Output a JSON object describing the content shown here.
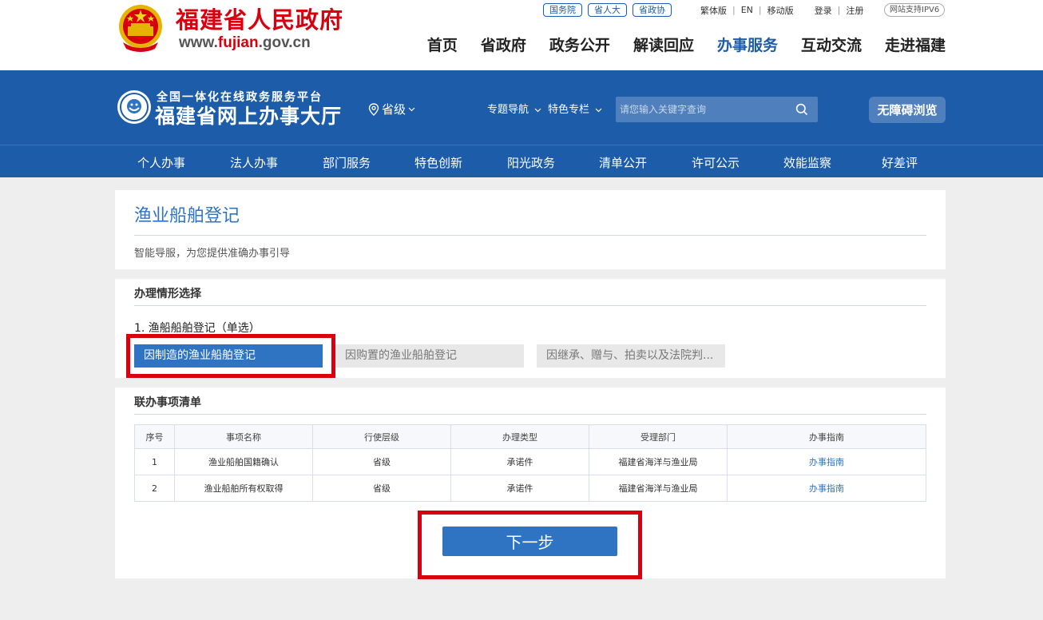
{
  "header": {
    "site_title": "福建省人民政府",
    "url_prefix": "www.",
    "url_highlight": "fujian",
    "url_suffix": ".gov.cn",
    "gov_links": [
      "国务院",
      "省人大",
      "省政协"
    ],
    "util_links": {
      "traditional": "繁体版",
      "english": "EN",
      "mobile": "移动版",
      "login": "登录",
      "register": "注册"
    },
    "ipv6_badge": "网站支持IPV6",
    "main_nav": [
      "首页",
      "省政府",
      "政务公开",
      "解读回应",
      "办事服务",
      "互动交流",
      "走进福建"
    ],
    "main_nav_active": "办事服务"
  },
  "banner": {
    "subtitle": "全国一体化在线政务服务平台",
    "title": "福建省网上办事大厅",
    "region": "省级",
    "menu": [
      "专题导航",
      "特色专栏"
    ],
    "search_placeholder": "请您输入关键字查询",
    "accessibility_label": "无障碍浏览"
  },
  "category_nav": [
    "个人办事",
    "法人办事",
    "部门服务",
    "特色创新",
    "阳光政务",
    "清单公开",
    "许可公示",
    "效能监察",
    "好差评"
  ],
  "page": {
    "title": "渔业船舶登记",
    "description": "智能导服，为您提供准确办事引导"
  },
  "situation": {
    "section_title": "办理情形选择",
    "question": "1. 渔船船舶登记（单选）",
    "options": [
      "因制造的渔业船舶登记",
      "因购置的渔业船舶登记",
      "因继承、赠与、拍卖以及法院判..."
    ],
    "selected_index": 0
  },
  "joint_list": {
    "section_title": "联办事项清单",
    "columns": [
      "序号",
      "事项名称",
      "行使层级",
      "办理类型",
      "受理部门",
      "办事指南"
    ],
    "rows": [
      [
        "1",
        "渔业船舶国籍确认",
        "省级",
        "承诺件",
        "福建省海洋与渔业局",
        "办事指南"
      ],
      [
        "2",
        "渔业船舶所有权取得",
        "省级",
        "承诺件",
        "福建省海洋与渔业局",
        "办事指南"
      ]
    ],
    "next_label": "下一步"
  },
  "colors": {
    "brand_blue": "#1c5ca8",
    "accent_blue": "#2f74c3",
    "title_red": "#d7000f",
    "highlight_red": "#d8000f"
  }
}
